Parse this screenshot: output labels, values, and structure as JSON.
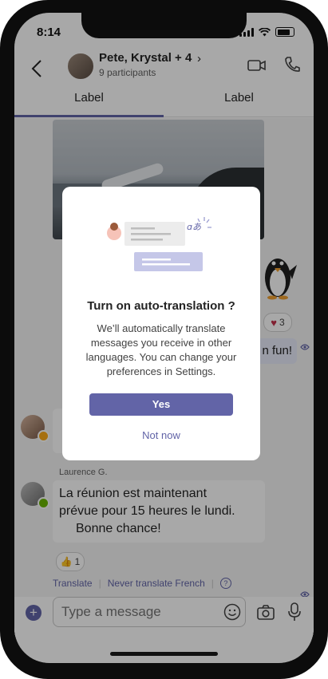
{
  "status": {
    "time": "8:14"
  },
  "header": {
    "title": "Pete, Krystal + 4",
    "subtitle": "9 participants"
  },
  "tabs": [
    {
      "label": "Label"
    },
    {
      "label": "Label"
    }
  ],
  "chat": {
    "reaction_heart": {
      "count": "3"
    },
    "my_message_fragment": "n fun!",
    "sender": "Laurence G.",
    "message_lines": [
      "La réunion est maintenant",
      "prévue pour 15 heures le lundi.",
      "Bonne chance!"
    ],
    "reaction_like": {
      "count": "1"
    },
    "translate_link": "Translate",
    "never_translate_link": "Never translate French",
    "separator": "|"
  },
  "compose": {
    "placeholder": "Type a message"
  },
  "dialog": {
    "illustration_label": "ɑあ",
    "title": "Turn on auto-translation ?",
    "body_lines": [
      "We’ll automatically translate",
      "messages you receive in other",
      "languages. You can change your",
      "preferences in Settings."
    ],
    "yes_label": "Yes",
    "notnow_label": "Not now"
  },
  "colors": {
    "accent": "#6264a7",
    "presence_away": "#fcaa19",
    "presence_available": "#6bb700"
  },
  "icons": [
    "back-arrow-icon",
    "chevron-right-icon",
    "video-call-icon",
    "phone-call-icon",
    "heart-icon",
    "thumbs-up-icon",
    "seen-eye-icon",
    "plus-icon",
    "emoji-icon",
    "camera-icon",
    "microphone-icon",
    "help-icon"
  ]
}
